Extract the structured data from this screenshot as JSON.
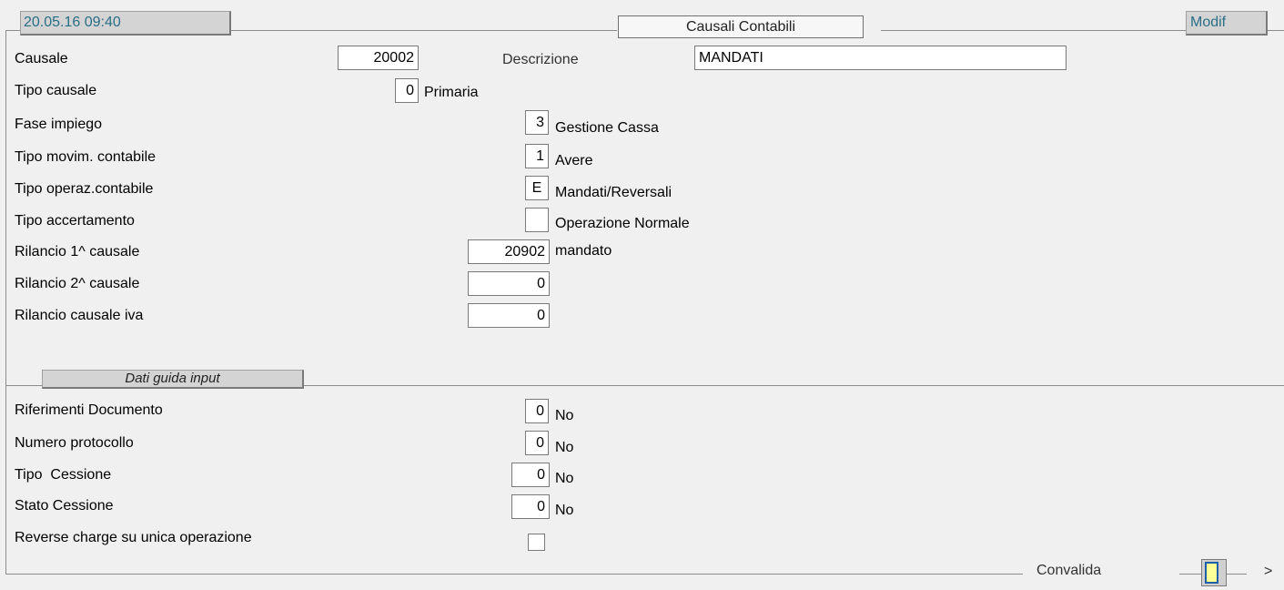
{
  "header": {
    "datetime": "20.05.16 09:40",
    "title": "Causali Contabili",
    "mode": "Modif"
  },
  "form": {
    "causale": {
      "label": "Causale",
      "value": "20002"
    },
    "descrizione": {
      "label": "Descrizione",
      "value": "MANDATI"
    },
    "tipo_causale": {
      "label": "Tipo causale",
      "value": "0",
      "desc": "Primaria"
    },
    "fase_impiego": {
      "label": "Fase impiego",
      "value": "3",
      "desc": "Gestione Cassa"
    },
    "tipo_movim": {
      "label": "Tipo movim. contabile",
      "value": "1",
      "desc": "Avere"
    },
    "tipo_operaz": {
      "label": "Tipo operaz.contabile",
      "value": "E",
      "desc": "Mandati/Reversali"
    },
    "tipo_accertamento": {
      "label": "Tipo accertamento",
      "value": "",
      "desc": "Operazione Normale"
    },
    "rilancio1": {
      "label": "Rilancio 1^ causale",
      "value": "20902",
      "desc": "mandato"
    },
    "rilancio2": {
      "label": "Rilancio 2^ causale",
      "value": "0"
    },
    "rilancio_iva": {
      "label": "Rilancio causale iva",
      "value": "0"
    }
  },
  "section": {
    "title": "Dati guida input"
  },
  "guida": {
    "riferimenti": {
      "label": "Riferimenti Documento",
      "value": "0",
      "desc": "No"
    },
    "protocollo": {
      "label": "Numero protocollo",
      "value": "0",
      "desc": "No"
    },
    "tipo_cessione": {
      "label": "Tipo  Cessione",
      "value": "0",
      "desc": "No"
    },
    "stato_cessione": {
      "label": "Stato Cessione",
      "value": "0",
      "desc": "No"
    },
    "reverse_charge": {
      "label": "Reverse charge su unica operazione",
      "checked": false
    }
  },
  "footer": {
    "convalida": "Convalida",
    "next": ">"
  },
  "colors": {
    "header_text": "#2a6f86",
    "button_fill": "#ffff99",
    "button_border": "#1e5fa8"
  }
}
